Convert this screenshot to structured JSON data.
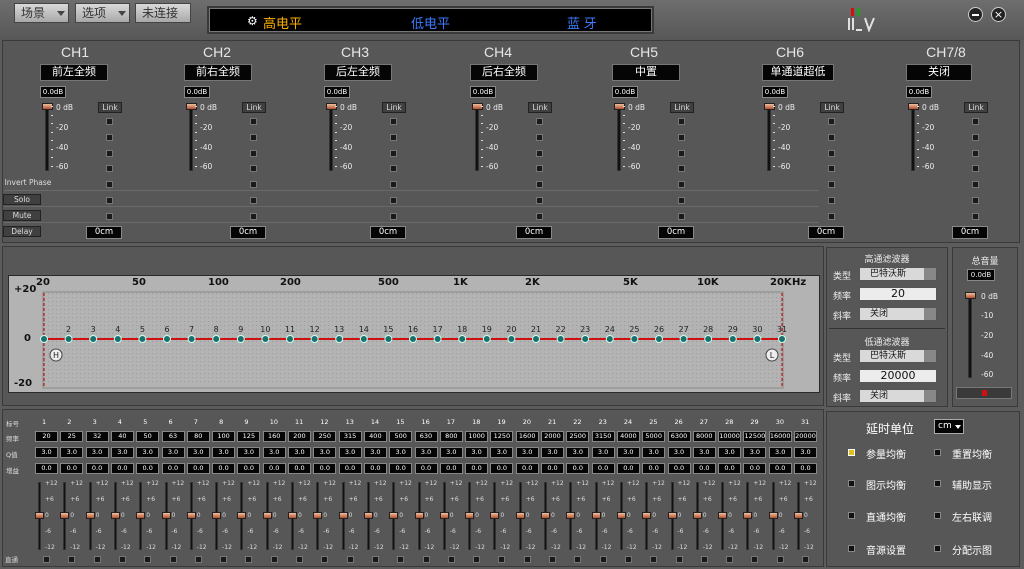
{
  "topbar": {
    "scene_label": "场景",
    "options_label": "选项",
    "connection_label": "未连接",
    "modes": [
      "高电平",
      "低电平",
      "蓝 牙"
    ],
    "mode_active": "高电平"
  },
  "channels": [
    {
      "name": "CH1",
      "assign": "前左全频",
      "gain": "0.0dB",
      "delay": "0cm"
    },
    {
      "name": "CH2",
      "assign": "前右全频",
      "gain": "0.0dB",
      "delay": "0cm"
    },
    {
      "name": "CH3",
      "assign": "后左全频",
      "gain": "0.0dB",
      "delay": "0cm"
    },
    {
      "name": "CH4",
      "assign": "后右全频",
      "gain": "0.0dB",
      "delay": "0cm"
    },
    {
      "name": "CH5",
      "assign": "中置",
      "gain": "0.0dB",
      "delay": "0cm"
    },
    {
      "name": "CH6",
      "assign": "单通道超低",
      "gain": "0.0dB",
      "delay": "0cm"
    },
    {
      "name": "CH7/8",
      "assign": "关闭",
      "gain": "0.0dB",
      "delay": "0cm"
    }
  ],
  "channel_scale": [
    "0 dB",
    "-20",
    "-40",
    "-60"
  ],
  "row_labels": {
    "link": "Link",
    "invert": "Invert Phase",
    "solo": "Solo",
    "mute": "Mute",
    "delay": "Delay"
  },
  "eq_graph": {
    "freq_labels": [
      "20",
      "50",
      "100",
      "200",
      "500",
      "1K",
      "2K",
      "5K",
      "10K",
      "20K",
      "Hz"
    ],
    "y_labels": [
      "+20",
      "0",
      "-20"
    ],
    "band_numbers": [
      "1",
      "2",
      "3",
      "4",
      "5",
      "6",
      "7",
      "8",
      "9",
      "10",
      "11",
      "12",
      "13",
      "14",
      "15",
      "16",
      "17",
      "18",
      "19",
      "20",
      "21",
      "22",
      "23",
      "24",
      "25",
      "26",
      "27",
      "28",
      "29",
      "30",
      "31"
    ],
    "hp_marker": "H",
    "lp_marker": "L"
  },
  "highpass": {
    "title": "高通滤波器",
    "type_label": "类型",
    "type": "巴特沃斯",
    "freq_label": "频率",
    "freq": "20",
    "slope_label": "斜率",
    "slope": "关闭"
  },
  "lowpass": {
    "title": "低通滤波器",
    "type_label": "类型",
    "type": "巴特沃斯",
    "freq_label": "频率",
    "freq": "20000",
    "slope_label": "斜率",
    "slope": "关闭"
  },
  "master": {
    "title": "总音量",
    "value": "0.0dB",
    "scale": [
      "0 dB",
      "-10",
      "-20",
      "-40",
      "-60"
    ]
  },
  "eq_table": {
    "row_labels": [
      "标号",
      "频率",
      "Q值",
      "增益"
    ],
    "freqs": [
      "20",
      "25",
      "32",
      "40",
      "50",
      "63",
      "80",
      "100",
      "125",
      "160",
      "200",
      "250",
      "315",
      "400",
      "500",
      "630",
      "800",
      "1000",
      "1250",
      "1600",
      "2000",
      "2500",
      "3150",
      "4000",
      "5000",
      "6300",
      "8000",
      "10000",
      "12500",
      "16000",
      "20000"
    ],
    "q": "3.0",
    "gain": "0.0",
    "slider_scale": [
      "+12",
      "+6",
      "0",
      "-6",
      "-12"
    ],
    "bypass_label": "直通"
  },
  "right_panel": {
    "delay_unit_label": "延时单位",
    "delay_unit": "cm",
    "buttons": [
      "参量均衡",
      "重置均衡",
      "图示均衡",
      "辅助显示",
      "直通均衡",
      "左右联调",
      "音源设置",
      "分配示图"
    ]
  },
  "colors": {
    "accent_curve": "#d01010",
    "node": "#1e6e6e",
    "thumb": "#c06040"
  }
}
